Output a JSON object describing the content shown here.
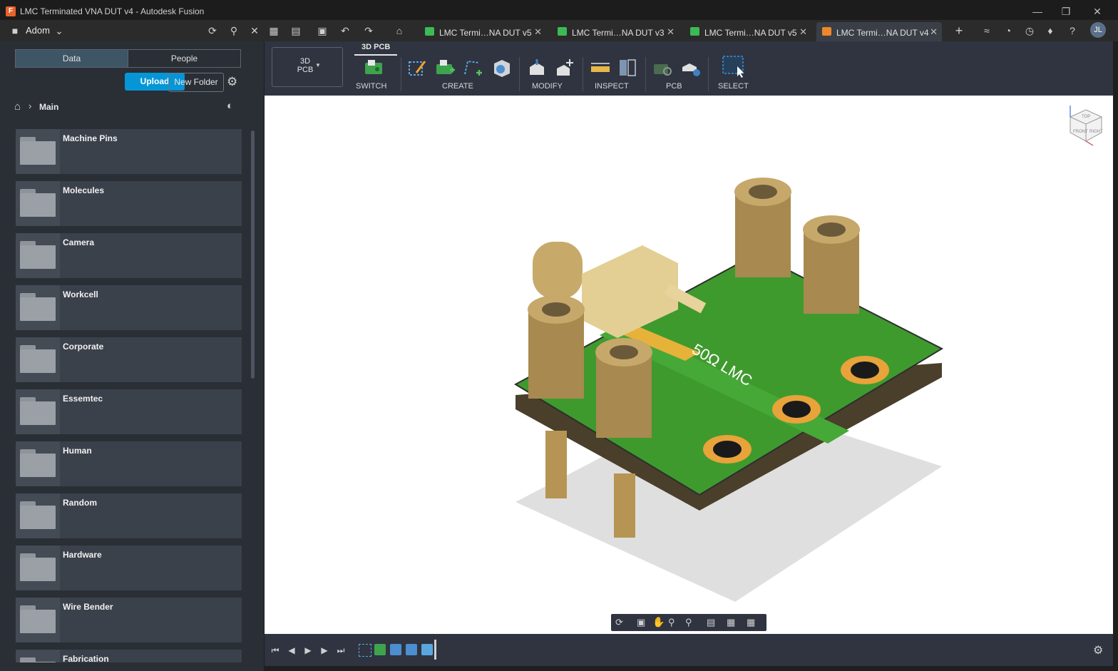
{
  "window": {
    "title": "LMC Terminated VNA DUT v4 - Autodesk Fusion",
    "logo_letter": "F"
  },
  "tabbar": {
    "team_name": "Adom",
    "doc_tabs": [
      {
        "label": "LMC Termi…NA DUT v5",
        "color": "#3cba54"
      },
      {
        "label": "LMC Termi…NA DUT v3",
        "color": "#3cba54"
      },
      {
        "label": "LMC Termi…NA DUT v5",
        "color": "#3cba54"
      },
      {
        "label": "LMC Termi…NA DUT v4",
        "color": "#f0872b"
      }
    ],
    "user_initials": "JL"
  },
  "data_panel": {
    "tabs": [
      "Data",
      "People"
    ],
    "upload_label": "Upload",
    "new_folder_label": "New Folder",
    "breadcrumb": "Main",
    "folders": [
      "Machine Pins",
      "Molecules",
      "Camera",
      "Workcell",
      "Corporate",
      "Essemtec",
      "Human",
      "Random",
      "Hardware",
      "Wire Bender",
      "Fabrication"
    ]
  },
  "toolbar": {
    "workspace_label_line1": "3D",
    "workspace_label_line2": "PCB",
    "active_tab": "3D PCB",
    "groups": [
      "SWITCH",
      "CREATE",
      "MODIFY",
      "INSPECT",
      "PCB",
      "SELECT"
    ]
  },
  "board": {
    "trace_label": "50Ω LMC"
  },
  "viewcube": {
    "top": "TOP",
    "front": "FRONT",
    "right": "RIGHT"
  }
}
